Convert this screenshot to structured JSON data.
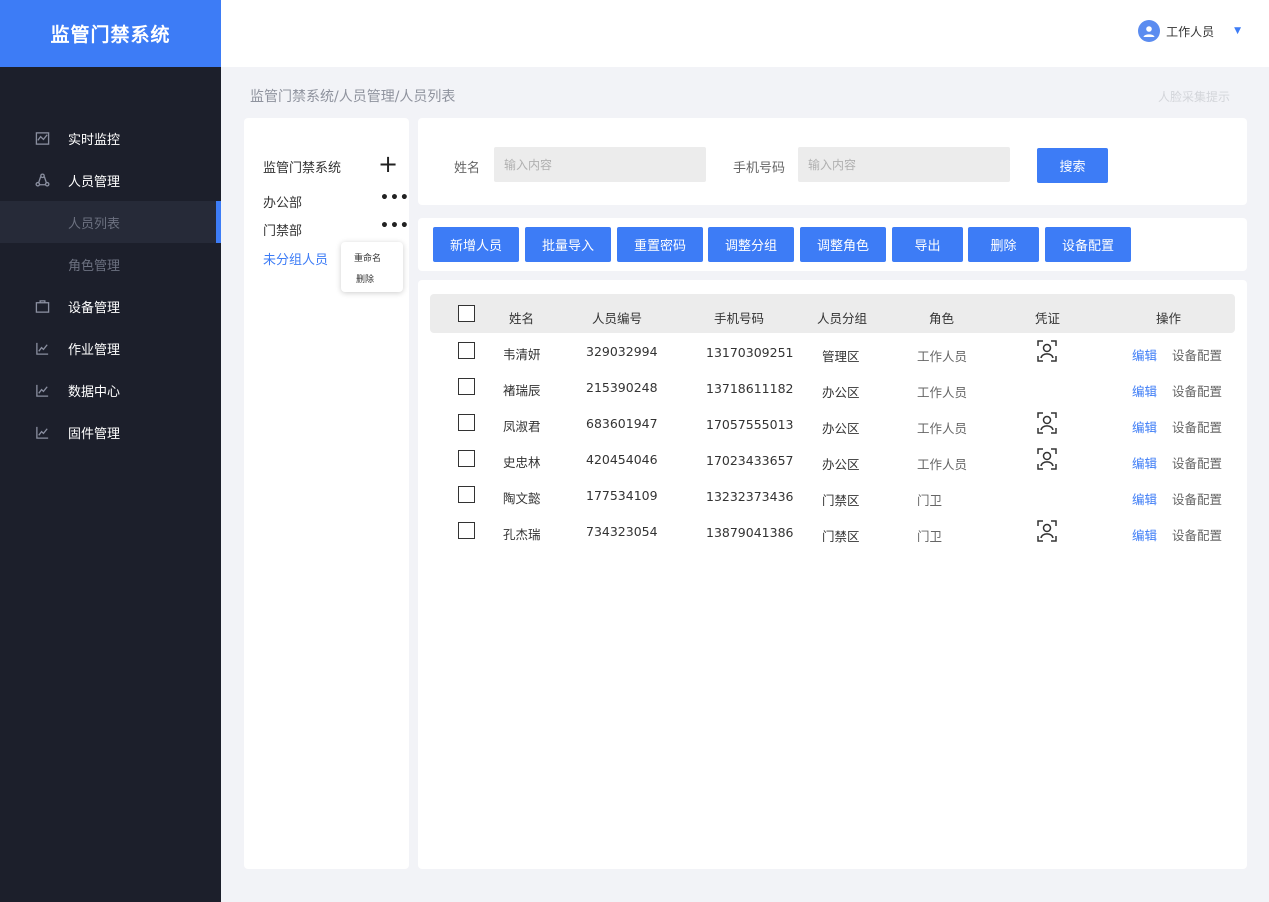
{
  "app_title": "监管门禁系统",
  "sidebar": {
    "items": [
      {
        "label": "实时监控",
        "icon": "monitor-chart-icon",
        "type": "main"
      },
      {
        "label": "人员管理",
        "icon": "people-cycle-icon",
        "type": "main"
      },
      {
        "label": "人员列表",
        "type": "sub",
        "active": true
      },
      {
        "label": "角色管理",
        "type": "sub"
      },
      {
        "label": "设备管理",
        "icon": "briefcase-icon",
        "type": "main"
      },
      {
        "label": "作业管理",
        "icon": "trend-chart-icon",
        "type": "main"
      },
      {
        "label": "数据中心",
        "icon": "trend-chart-icon",
        "type": "main"
      },
      {
        "label": "固件管理",
        "icon": "trend-chart-icon",
        "type": "main"
      }
    ]
  },
  "header": {
    "user_name": "工作人员",
    "caret": "▼"
  },
  "breadcrumb": "监管门禁系统/人员管理/人员列表",
  "hint": "人脸采集提示",
  "tree": {
    "root": "监管门禁系统",
    "add_symbol": "+",
    "groups": [
      "办公部",
      "门禁部",
      "未分组人员"
    ],
    "more_symbol": "•••",
    "context_menu": [
      "重命名",
      "删除"
    ]
  },
  "search": {
    "name_label": "姓名",
    "name_placeholder": "输入内容",
    "phone_label": "手机号码",
    "phone_placeholder": "输入内容",
    "search_button": "搜索"
  },
  "toolbar": [
    "新增人员",
    "批量导入",
    "重置密码",
    "调整分组",
    "调整角色",
    "导出",
    "删除",
    "设备配置"
  ],
  "table": {
    "columns": [
      "姓名",
      "人员编号",
      "手机号码",
      "人员分组",
      "角色",
      "凭证",
      "操作"
    ],
    "rows": [
      {
        "name": "韦清妍",
        "id": "329032994",
        "phone": "13170309251",
        "group": "管理区",
        "role": "工作人员",
        "credential": true
      },
      {
        "name": "褚瑞辰",
        "id": "215390248",
        "phone": "13718611182",
        "group": "办公区",
        "role": "工作人员",
        "credential": false
      },
      {
        "name": "凤淑君",
        "id": "683601947",
        "phone": "17057555013",
        "group": "办公区",
        "role": "工作人员",
        "credential": true
      },
      {
        "name": "史忠林",
        "id": "420454046",
        "phone": "17023433657",
        "group": "办公区",
        "role": "工作人员",
        "credential": true
      },
      {
        "name": "陶文懿",
        "id": "177534109",
        "phone": "13232373436",
        "group": "门禁区",
        "role": "门卫",
        "credential": false
      },
      {
        "name": "孔杰瑞",
        "id": "734323054",
        "phone": "13879041386",
        "group": "门禁区",
        "role": "门卫",
        "credential": true
      }
    ],
    "edit_label": "编辑",
    "config_label": "设备配置"
  },
  "colors": {
    "accent": "#3d7cf6",
    "sidebar_bg": "#1c1f2b",
    "page_bg": "#f2f3f7"
  }
}
